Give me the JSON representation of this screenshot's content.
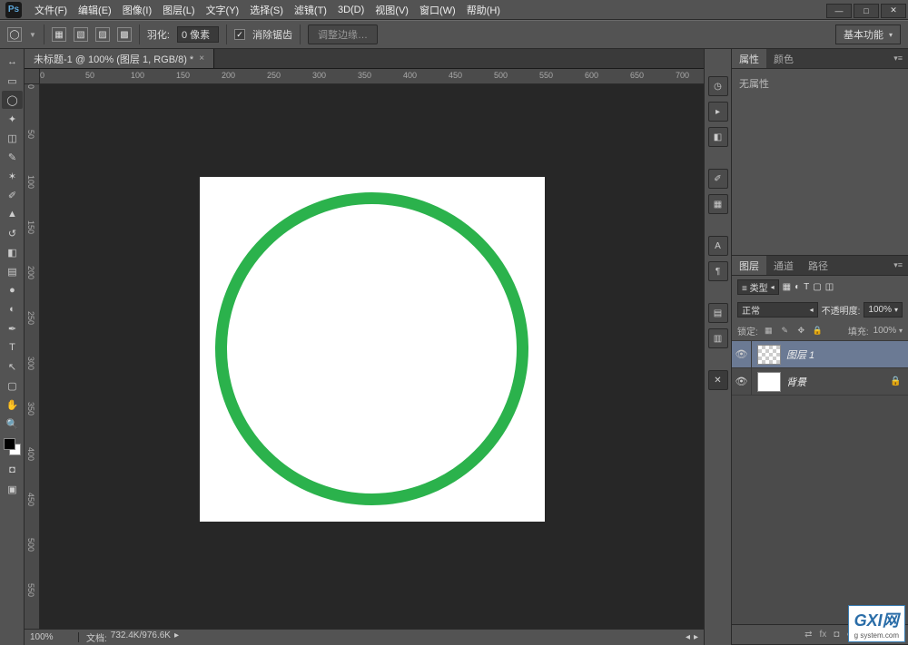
{
  "app": {
    "logo": "Ps"
  },
  "menu": {
    "file": "文件(F)",
    "edit": "编辑(E)",
    "image": "图像(I)",
    "layer": "图层(L)",
    "type": "文字(Y)",
    "select": "选择(S)",
    "filter": "滤镜(T)",
    "threed": "3D(D)",
    "view": "视图(V)",
    "window": "窗口(W)",
    "help": "帮助(H)"
  },
  "options": {
    "feather_label": "羽化:",
    "feather_value": "0 像素",
    "antialias_label": "消除锯齿",
    "refine_label": "调整边缘…",
    "workspace": "基本功能"
  },
  "doc": {
    "tab_title": "未标题-1 @ 100% (图层 1, RGB/8) *",
    "zoom": "100%",
    "filesize_label": "文档:",
    "filesize": "732.4K/976.6K"
  },
  "ruler_h": [
    "0",
    "50",
    "100",
    "150",
    "200",
    "250",
    "300",
    "350",
    "400",
    "450",
    "500",
    "550",
    "600",
    "650",
    "700"
  ],
  "ruler_v": [
    "0",
    "50",
    "100",
    "150",
    "200",
    "250",
    "300",
    "350",
    "400",
    "450",
    "500",
    "550"
  ],
  "panels": {
    "props_tab": "属性",
    "color_tab": "颜色",
    "props_empty": "无属性",
    "layers_tab": "图层",
    "channels_tab": "通道",
    "paths_tab": "路径",
    "kind_label": "≡ 类型",
    "blend": "正常",
    "opacity_label": "不透明度:",
    "opacity_val": "100%",
    "lock_label": "锁定:",
    "fill_label": "填充:",
    "fill_val": "100%",
    "layer1": "图层 1",
    "bg_layer": "背景"
  },
  "watermark": {
    "brand": "GXI网",
    "url": "g system.com"
  }
}
